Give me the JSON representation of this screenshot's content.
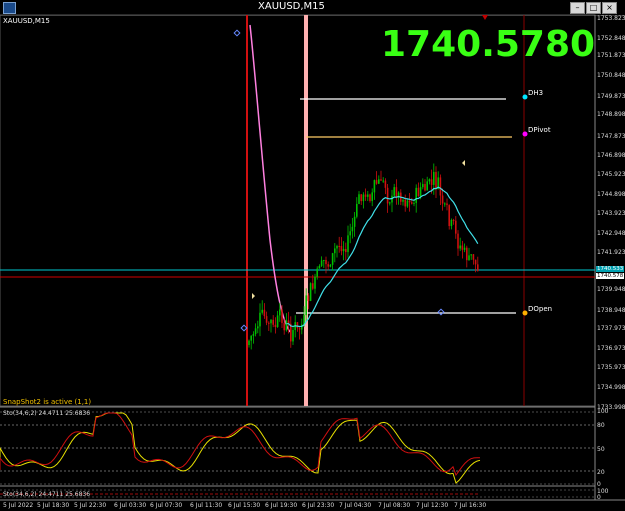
{
  "window": {
    "title": "XAUUSD,M15",
    "buttons": [
      "–",
      "□",
      "×"
    ]
  },
  "symbol_label": "XAUUSD,M15",
  "big_price": "1740.5780",
  "y_axis": {
    "labels": [
      "1753.823",
      "1752.848",
      "1751.873",
      "1750.848",
      "1749.873",
      "1748.898",
      "1747.873",
      "1746.898",
      "1745.923",
      "1744.898",
      "1743.923",
      "1742.948",
      "1741.923",
      "1740.533",
      "1740.578",
      "1739.948",
      "1738.948",
      "1737.973",
      "1736.973",
      "1735.973",
      "1734.998",
      "1733.998"
    ],
    "current_tag": "1740.533",
    "bid_tag": "1740.578"
  },
  "levels": [
    {
      "name": "DH3",
      "color": "#00e5ff"
    },
    {
      "name": "DPivot",
      "color": "#ff00ff"
    },
    {
      "name": "DOpen",
      "color": "#ffb000"
    }
  ],
  "status_text": "SnapShot2 is active (1,1)",
  "indicator1": {
    "title": "Sto(34,6,2) 24.4711 25.6836",
    "levels": [
      "100",
      "80",
      "50",
      "20",
      "0"
    ]
  },
  "indicator2": {
    "title": "Sto(34,6,2) 24.4711 25.6836",
    "levels": [
      "100",
      "0"
    ]
  },
  "x_axis": {
    "labels": [
      "5 Jul 2022",
      "5 Jul 18:30",
      "5 Jul 22:30",
      "6 Jul 03:30",
      "6 Jul 07:30",
      "6 Jul 11:30",
      "6 Jul 15:30",
      "6 Jul 19:30",
      "6 Jul 23:30",
      "7 Jul 04:30",
      "7 Jul 08:30",
      "7 Jul 12:30",
      "7 Jul 16:30"
    ]
  },
  "colors": {
    "bull": "#00c000",
    "bear": "#d01010",
    "ma": "#40e0e8",
    "pink_curve": "#ff80e0",
    "vline": "#ffb0b0",
    "cur_line": "#00c8d0",
    "bid_line": "#d00000"
  }
}
